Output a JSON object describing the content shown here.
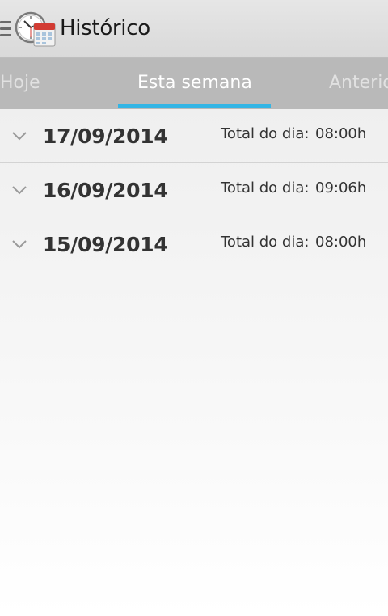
{
  "action_bar": {
    "title": "Histórico",
    "menu_icon": "hamburger-icon",
    "app_icon": "clock-calendar-icon"
  },
  "tabs": [
    {
      "label": "Hoje",
      "selected": false
    },
    {
      "label": "Esta semana",
      "selected": true
    },
    {
      "label": "Anterior",
      "selected": false
    }
  ],
  "colors": {
    "accent": "#33b5e5",
    "tab_strip": "#b9b9b9",
    "action_bar": "#dddddd"
  },
  "days": [
    {
      "date": "17/09/2014",
      "total_label": "Total do dia:",
      "total": "08:00h"
    },
    {
      "date": "16/09/2014",
      "total_label": "Total do dia:",
      "total": "09:06h"
    },
    {
      "date": "15/09/2014",
      "total_label": "Total do dia:",
      "total": "08:00h"
    }
  ]
}
